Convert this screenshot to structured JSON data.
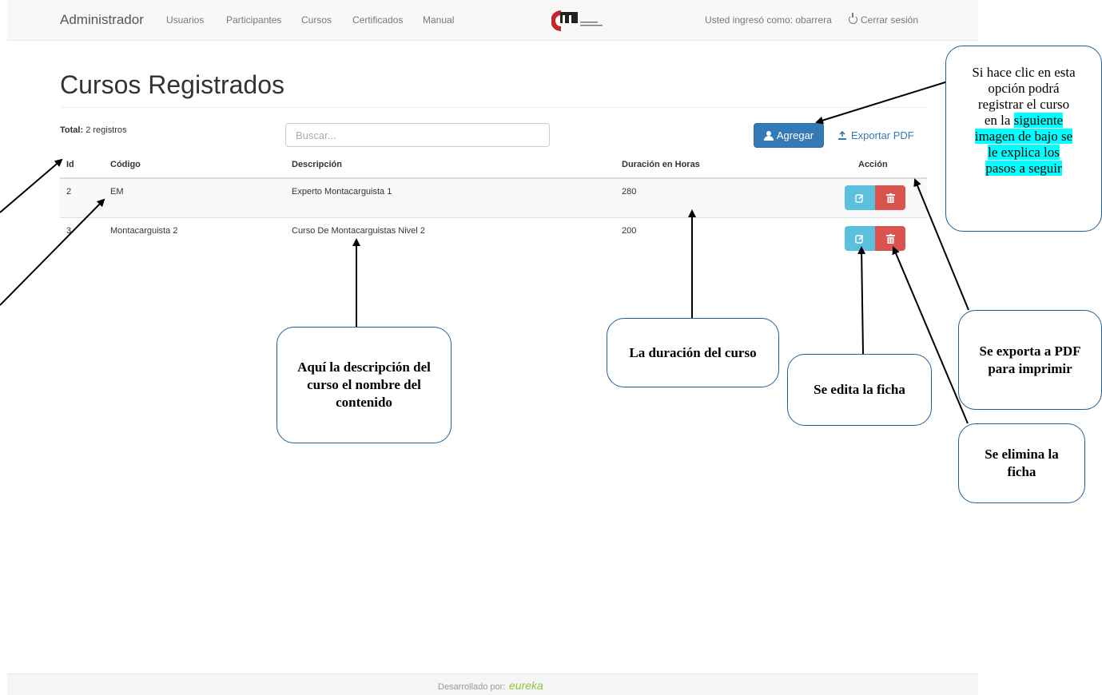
{
  "navbar": {
    "brand": "Administrador",
    "links": [
      "Usuarios",
      "Participantes",
      "Cursos",
      "Certificados",
      "Manual"
    ],
    "user_text": "Usted ingresó como: obarrera",
    "logout_label": "Cerrar sesión"
  },
  "page": {
    "title": "Cursos Registrados",
    "total_label": "Total:",
    "total_value": "2 registros",
    "search_placeholder": "Buscar...",
    "add_label": "Agregar",
    "export_label": "Exportar PDF"
  },
  "table": {
    "headers": [
      "Id",
      "Código",
      "Descripción",
      "Duración en Horas",
      "Acción"
    ],
    "rows": [
      {
        "id": "2",
        "codigo": "EM",
        "descripcion": "Experto Montacarguista 1",
        "duracion": "280"
      },
      {
        "id": "3",
        "codigo": "Montacarguista 2",
        "descripcion": "Curso De Montacarguistas Nivel 2",
        "duracion": "200"
      }
    ]
  },
  "callouts": {
    "agregar_line1": "Si hace clic en esta opción podrá registrar el curso en la",
    "agregar_line2": "siguiente imagen de bajo se le explica los pasos  a seguir",
    "descripcion": "Aquí la descripción del curso el nombre del contenido",
    "duracion": "La duración del curso",
    "editar": "Se edita la ficha",
    "exportar": "Se exporta  a PDF para imprimir",
    "eliminar": "Se elimina la ficha"
  },
  "footer": {
    "text": "Desarrollado por:",
    "brand": "eureka"
  },
  "colors": {
    "primary": "#337ab7",
    "edit": "#5bc0de",
    "delete": "#d9534f",
    "callout_border": "#1f5f9e",
    "highlight": "#00ffff"
  }
}
